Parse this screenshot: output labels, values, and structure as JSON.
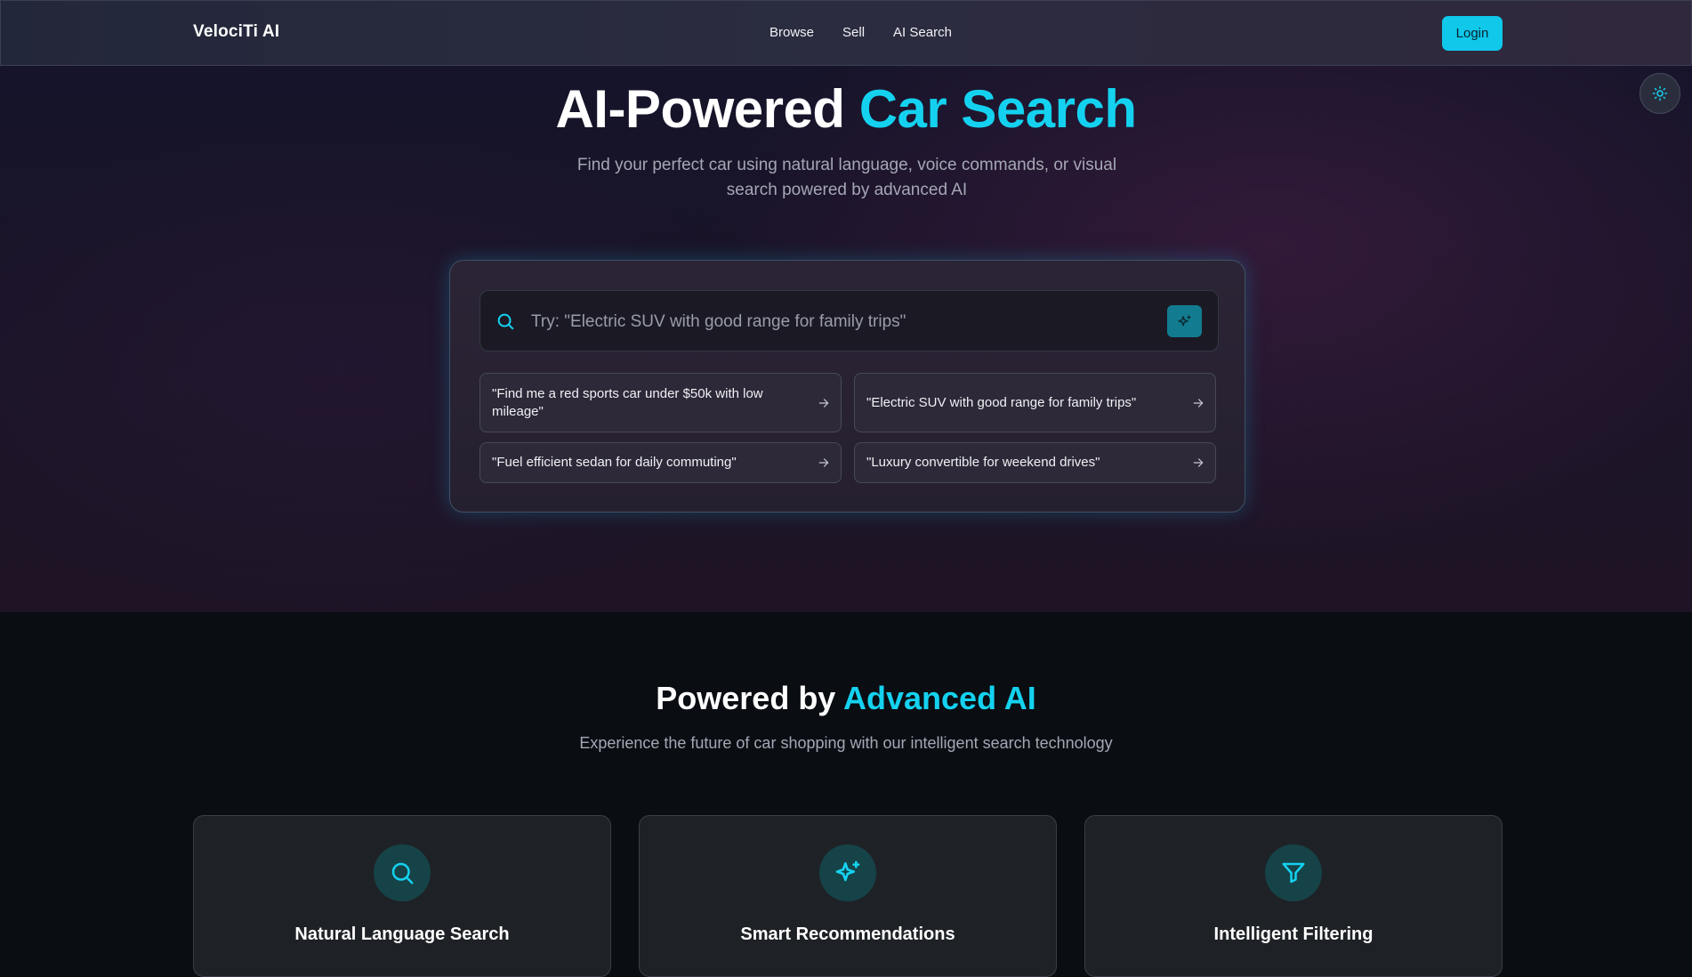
{
  "nav": {
    "brand": "VelociTi AI",
    "links": [
      "Browse",
      "Sell",
      "AI Search"
    ],
    "login_label": "Login"
  },
  "hero": {
    "title_part1": "AI-Powered",
    "title_part2": "Car Search",
    "subtitle": "Find your perfect car using natural language, voice commands, or visual search powered by advanced AI"
  },
  "search": {
    "placeholder": "Try: \"Electric SUV with good range for family trips\"",
    "suggestions": [
      "\"Find me a red sports car under $50k with low mileage\"",
      "\"Electric SUV with good range for family trips\"",
      "\"Fuel efficient sedan for daily commuting\"",
      "\"Luxury convertible for weekend drives\""
    ]
  },
  "features": {
    "title_part1": "Powered by",
    "title_part2": "Advanced AI",
    "subtitle": "Experience the future of car shopping with our intelligent search technology",
    "cards": [
      {
        "title": "Natural Language Search",
        "icon": "search-icon"
      },
      {
        "title": "Smart Recommendations",
        "icon": "sparkles-icon"
      },
      {
        "title": "Intelligent Filtering",
        "icon": "filter-icon"
      }
    ]
  },
  "colors": {
    "accent": "#14d2ef",
    "login_bg": "#0fc8ea",
    "page_bg": "#0a0d12"
  }
}
